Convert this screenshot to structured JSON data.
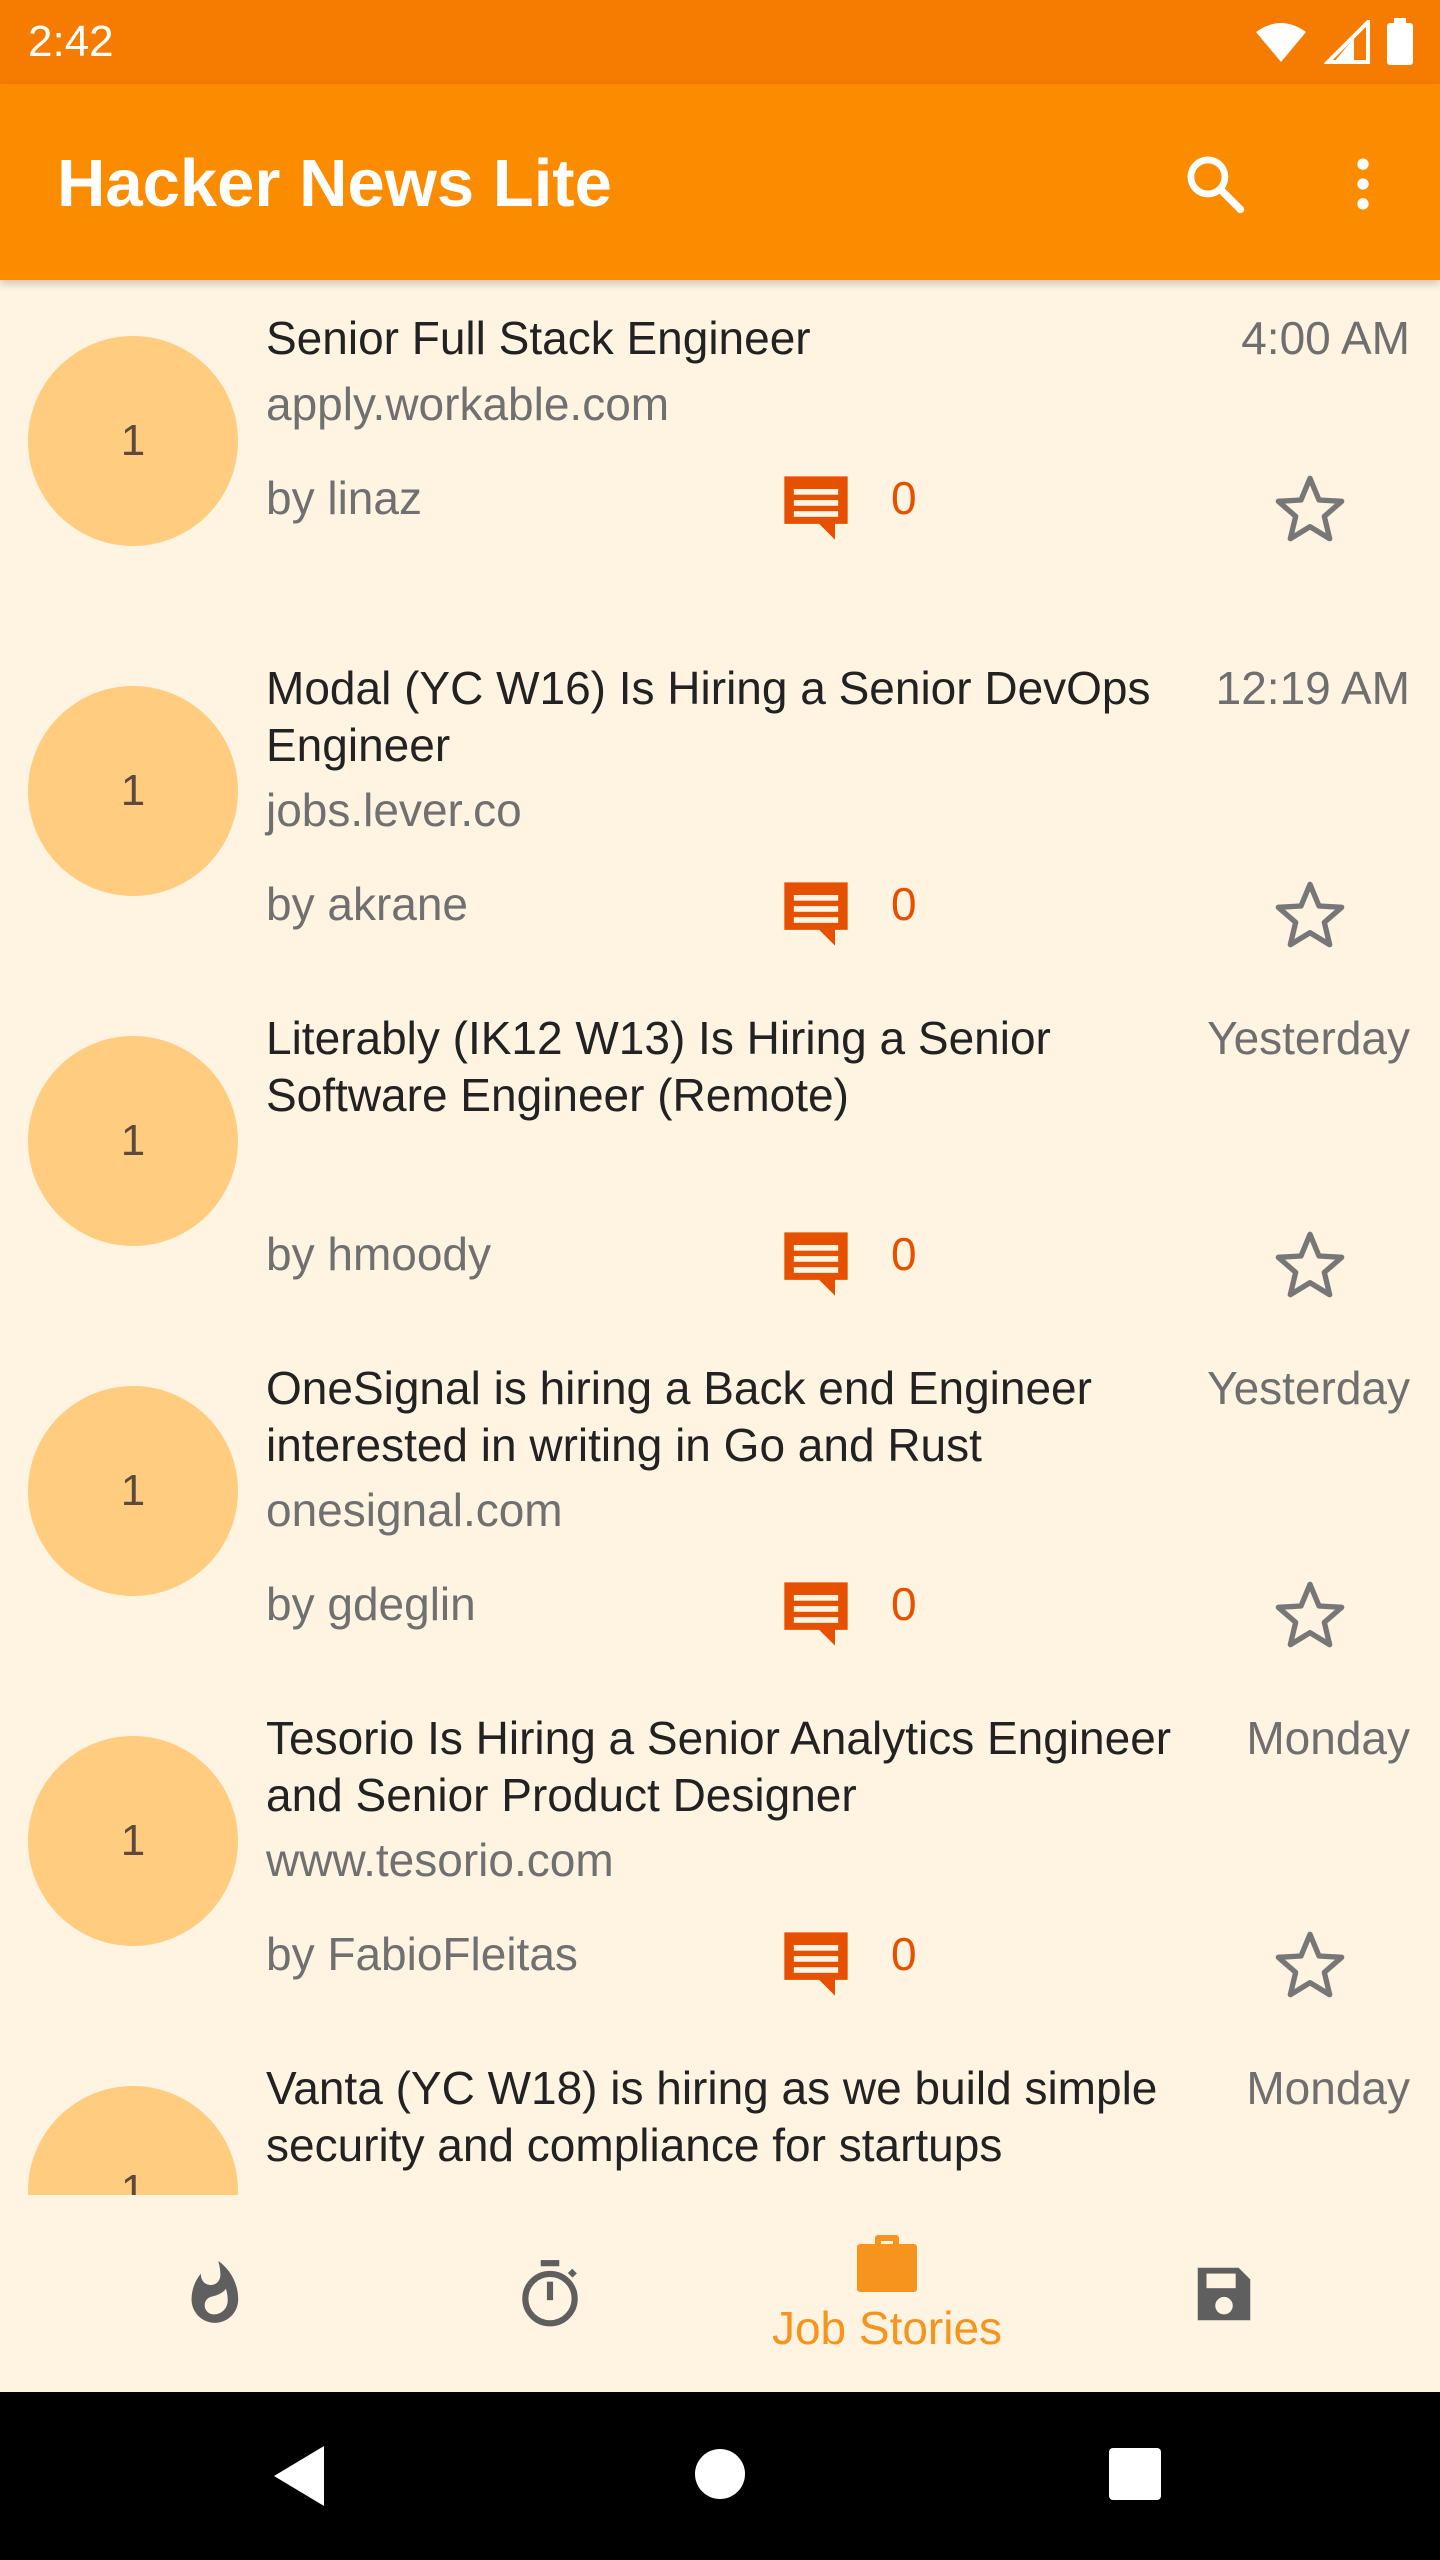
{
  "status_bar": {
    "time": "2:42"
  },
  "app_bar": {
    "title": "Hacker News Lite"
  },
  "stories": [
    {
      "rank": "1",
      "title": "Senior Full Stack Engineer",
      "time": "4:00 AM",
      "domain": "apply.workable.com",
      "author": "by linaz",
      "comments": "0"
    },
    {
      "rank": "1",
      "title": "Modal (YC W16) Is Hiring a Senior DevOps Engineer",
      "time": "12:19 AM",
      "domain": "jobs.lever.co",
      "author": "by akrane",
      "comments": "0"
    },
    {
      "rank": "1",
      "title": "Literably (IK12 W13) Is Hiring a Senior Software Engineer (Remote)",
      "time": "Yesterday",
      "domain": "",
      "author": "by hmoody",
      "comments": "0"
    },
    {
      "rank": "1",
      "title": "OneSignal is hiring a Back end Engineer interested in writing in Go and Rust",
      "time": "Yesterday",
      "domain": "onesignal.com",
      "author": "by gdeglin",
      "comments": "0"
    },
    {
      "rank": "1",
      "title": "Tesorio Is Hiring a Senior Analytics Engineer and Senior Product Designer",
      "time": "Monday",
      "domain": "www.tesorio.com",
      "author": "by FabioFleitas",
      "comments": "0"
    },
    {
      "rank": "1",
      "title": "Vanta (YC W18) is hiring as we build simple security and compliance for startups",
      "time": "Monday",
      "domain": "",
      "author": "",
      "comments": ""
    }
  ],
  "bottom_nav": {
    "items": [
      {
        "icon": "flame-icon",
        "label": ""
      },
      {
        "icon": "timer-icon",
        "label": ""
      },
      {
        "icon": "briefcase-icon",
        "label": "Job Stories",
        "selected": true
      },
      {
        "icon": "save-icon",
        "label": ""
      }
    ]
  },
  "colors": {
    "status_bar": "#f57c00",
    "app_bar": "#fb8c00",
    "background": "#fff3e1",
    "avatar": "#ffcc80",
    "accent": "#e65100",
    "nav_selected": "#f7941d"
  }
}
